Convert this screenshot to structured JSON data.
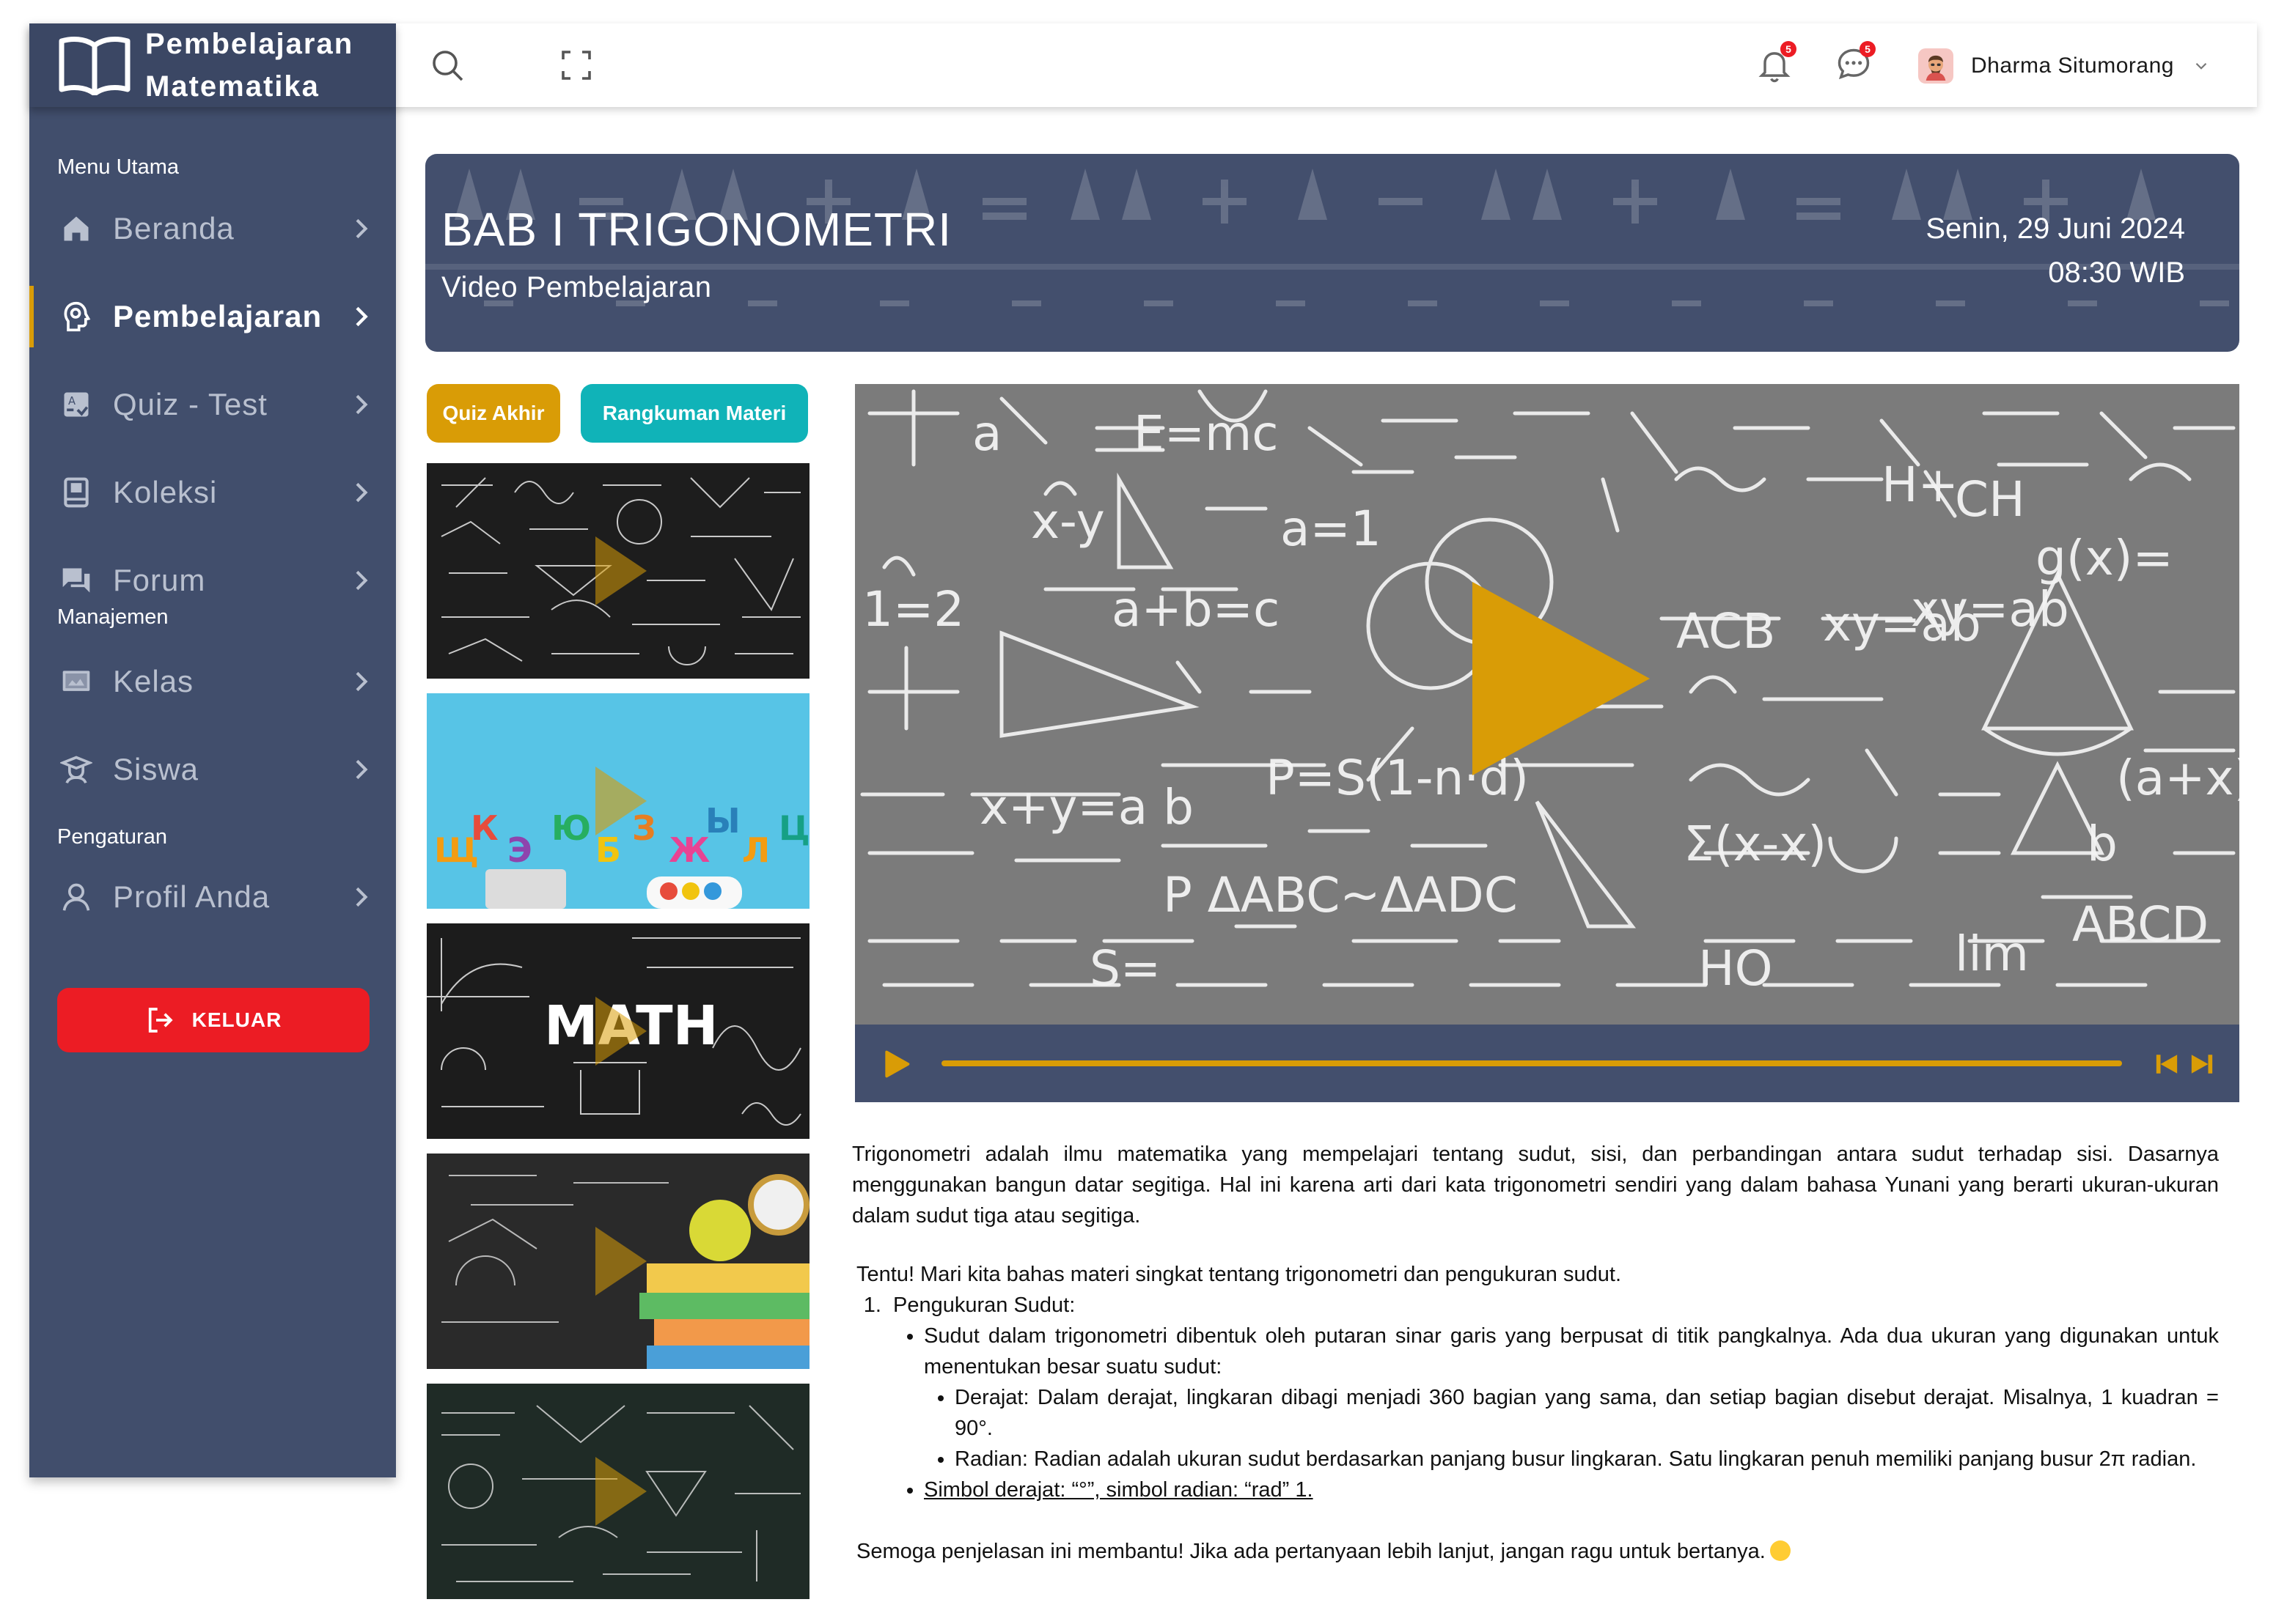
{
  "brand": {
    "line1": "Pembelajaran",
    "line2": "Matematika"
  },
  "sidebar": {
    "sections": {
      "main": "Menu Utama",
      "manage": "Manajemen",
      "settings": "Pengaturan"
    },
    "items": [
      {
        "label": "Beranda",
        "icon": "home-icon"
      },
      {
        "label": "Pembelajaran",
        "icon": "lightbulb-head-icon",
        "active": true
      },
      {
        "label": "Quiz - Test",
        "icon": "quiz-icon"
      },
      {
        "label": "Koleksi",
        "icon": "book-icon"
      },
      {
        "label": "Forum",
        "icon": "forum-icon"
      },
      {
        "label": "Kelas",
        "icon": "classroom-icon"
      },
      {
        "label": "Siswa",
        "icon": "student-icon"
      },
      {
        "label": "Profil Anda",
        "icon": "user-icon"
      }
    ],
    "logout_label": "KELUAR"
  },
  "topbar": {
    "notifications_count": "5",
    "messages_count": "5",
    "user_name": "Dharma Situmorang"
  },
  "banner": {
    "title": "BAB I TRIGONOMETRI",
    "subtitle": "Video Pembelajaran",
    "date": "Senin, 29 Juni 2024",
    "time": "08:30 WIB"
  },
  "actions": {
    "quiz": "Quiz Akhir",
    "summary": "Rangkuman Materi"
  },
  "thumbnails": [
    {
      "name": "chalkboard-formulas"
    },
    {
      "name": "colorful-letters"
    },
    {
      "name": "math-blackboard"
    },
    {
      "name": "books-apple-clock"
    },
    {
      "name": "green-board-science"
    }
  ],
  "thumb3_text": "MATH",
  "player": {
    "progress": 1.0
  },
  "content": {
    "paragraph": "Trigonometri adalah ilmu matematika yang mempelajari tentang sudut, sisi, dan perbandingan antara sudut terhadap sisi. Dasarnya menggunakan bangun datar segitiga. Hal ini karena arti dari kata trigonometri sendiri yang dalam bahasa Yunani yang berarti ukuran-ukuran dalam sudut tiga atau segitiga.",
    "intro": "Tentu! Mari kita bahas materi singkat tentang trigonometri dan pengukuran sudut.",
    "item1": "Pengukuran Sudut:",
    "bullet1": "Sudut dalam trigonometri dibentuk oleh putaran sinar garis yang berpusat di titik pangkalnya. Ada dua ukuran yang digunakan untuk menentukan besar suatu sudut:",
    "sub1": "Derajat: Dalam derajat, lingkaran dibagi menjadi 360 bagian yang sama, dan setiap bagian disebut derajat. Misalnya, 1 kuadran = 90°.",
    "sub2": "Radian: Radian adalah ukuran sudut berdasarkan panjang busur lingkaran. Satu lingkaran penuh memiliki panjang busur 2π radian.",
    "bullet2": "Simbol derajat: “°”, simbol radian: “rad” 1.",
    "closing": "Semoga penjelasan ini membantu! Jika ada pertanyaan lebih lanjut, jangan ragu untuk bertanya."
  },
  "colors": {
    "navy": "#414e6c",
    "accent": "#d99c06",
    "teal": "#10b3b8",
    "danger": "#ec1c24"
  }
}
